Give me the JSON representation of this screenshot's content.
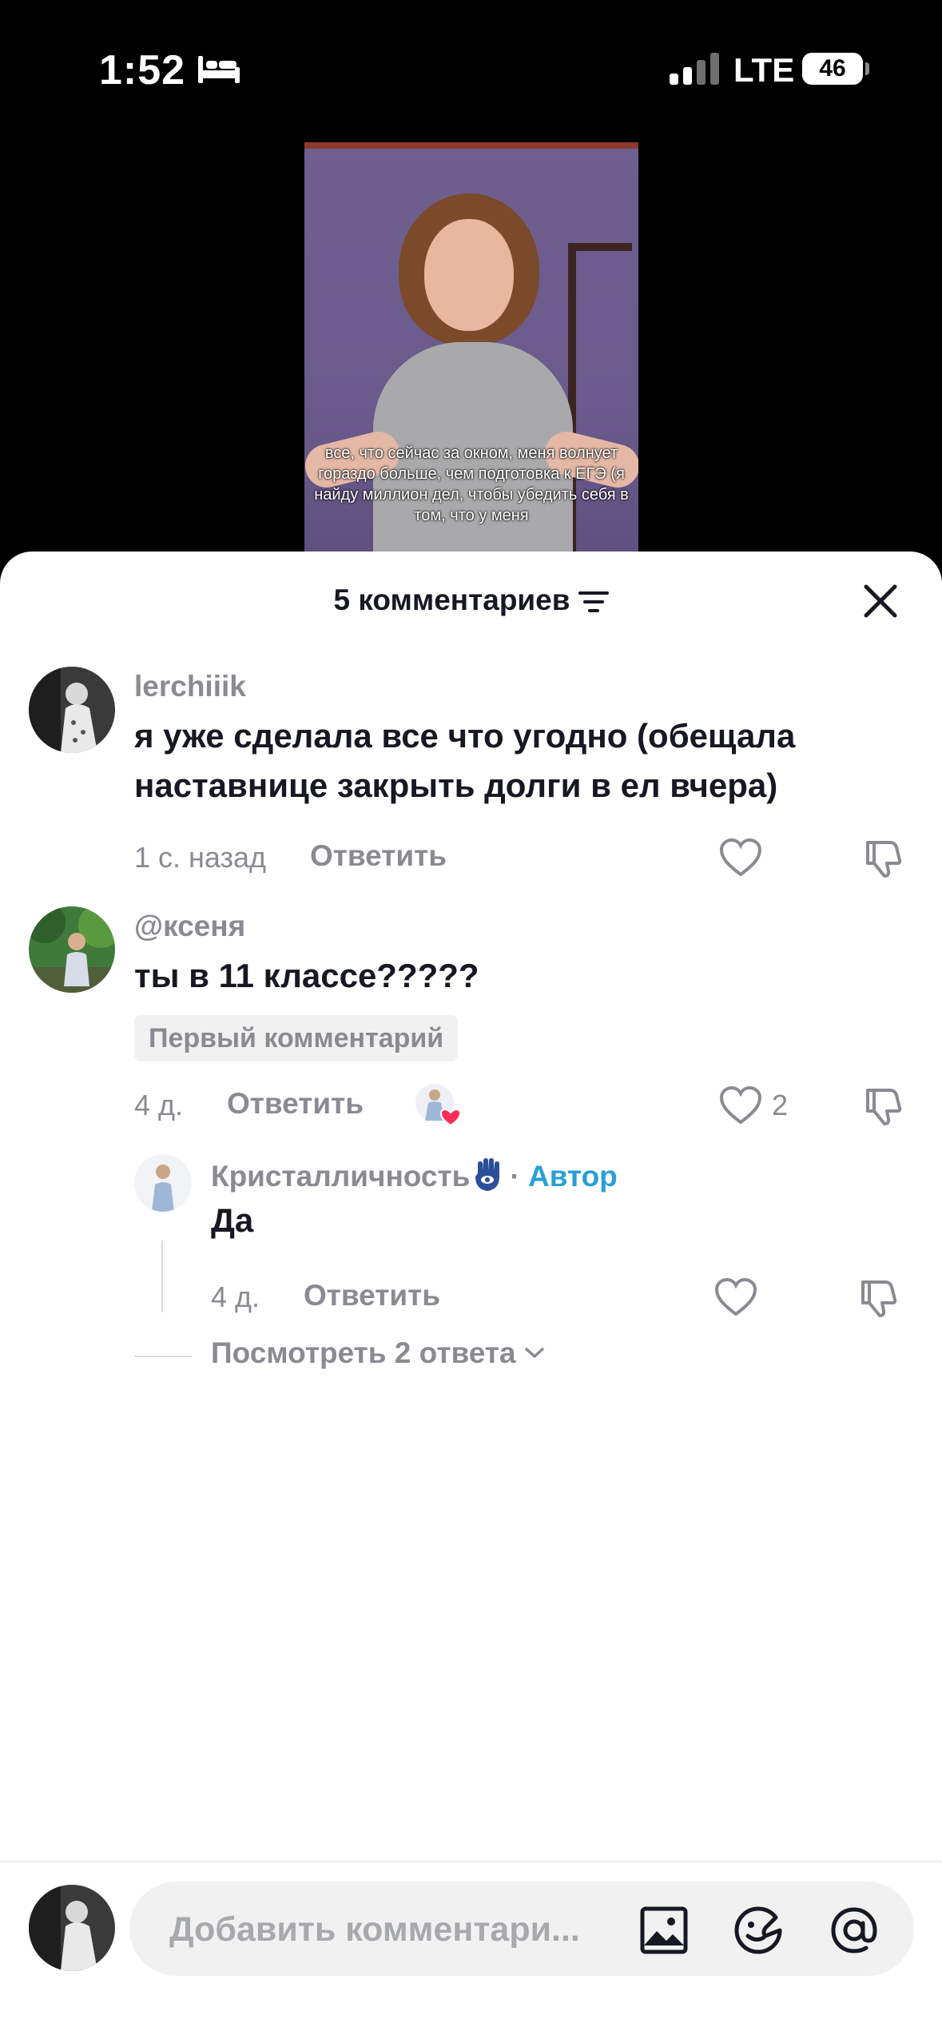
{
  "status_bar": {
    "time": "1:52",
    "network": "LTE",
    "battery": "46"
  },
  "video": {
    "caption": "все, что сейчас за окном, меня волнует гораздо больше, чем подготовка к ЕГЭ (я найду миллион дел, чтобы убедить себя в том, что у меня"
  },
  "comments_panel": {
    "title": "5 комментариев",
    "comments": [
      {
        "username": "lerchiiik",
        "text": "я уже сделала все что угодно (обещала наставнице закрыть долги в ел вчера)",
        "time": "1 с. назад",
        "reply_label": "Ответить"
      },
      {
        "username": "@ксеня",
        "text": "ты в 11 классе?????",
        "badge": "Первый комментарий",
        "time": "4 д.",
        "reply_label": "Ответить",
        "likes": "2",
        "reply": {
          "username": "Кристaлличность",
          "separator": "·",
          "author_label": "Автор",
          "text": "Да",
          "time": "4 д.",
          "reply_label": "Ответить"
        },
        "view_replies": "Посмотреть 2 ответа"
      }
    ]
  },
  "input": {
    "placeholder": "Добавить комментари..."
  },
  "colors": {
    "author": "#2a9fd6",
    "muted": "#8a8b91",
    "text": "#161823",
    "like_heart": "#fe2c55"
  }
}
